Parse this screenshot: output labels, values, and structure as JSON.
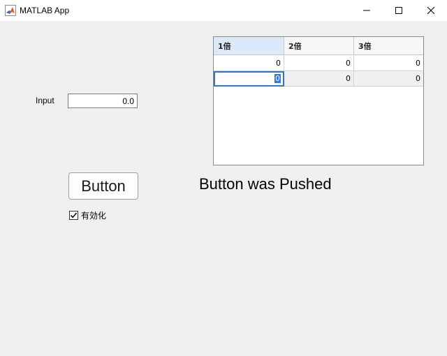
{
  "window": {
    "title": "MATLAB App",
    "icon": "matlab-logo-icon",
    "controls": [
      "minimize-icon",
      "maximize-icon",
      "close-icon"
    ]
  },
  "input": {
    "label": "Input",
    "value": "0.0"
  },
  "table": {
    "columns": [
      "1倍",
      "2倍",
      "3倍"
    ],
    "rows": [
      [
        "0",
        "0",
        "0"
      ],
      [
        "0",
        "0",
        "0"
      ]
    ],
    "selected_column": 0,
    "editing_cell": [
      1,
      0
    ]
  },
  "button": {
    "label": "Button"
  },
  "status": {
    "text": "Button was Pushed"
  },
  "checkbox": {
    "label": "有効化",
    "checked": true
  },
  "colors": {
    "background": "#f0f0f0",
    "header_selected": "#dbe9f8",
    "edit_highlight": "#3378d8"
  }
}
